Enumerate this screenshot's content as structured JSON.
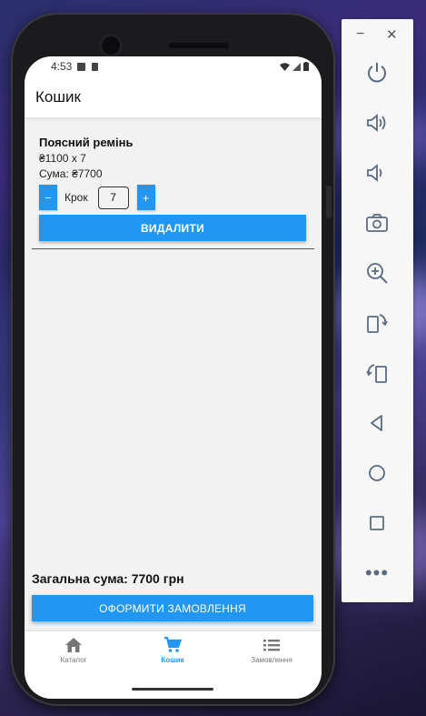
{
  "status_bar": {
    "time": "4:53"
  },
  "app_bar": {
    "title": "Кошик"
  },
  "cart_item": {
    "name": "Поясний ремінь",
    "price_line": "₴1100 x 7",
    "sum_line": "Сума: ₴7700",
    "minus_label": "−",
    "plus_label": "+",
    "step_label": "Крок",
    "quantity": "7",
    "delete_label": "ВИДАЛИТИ"
  },
  "footer": {
    "total": "Загальна сума: 7700 грн",
    "checkout_label": "ОФОРМИТИ ЗАМОВЛЕННЯ"
  },
  "bottom_nav": {
    "items": [
      {
        "label": "Каталог",
        "icon": "home-icon"
      },
      {
        "label": "Кошик",
        "icon": "cart-icon",
        "active": true
      },
      {
        "label": "Замовлення",
        "icon": "list-icon"
      }
    ]
  },
  "emulator_panel": {
    "minimize": "−",
    "close": "✕",
    "buttons": [
      "power-icon",
      "volume-up-icon",
      "volume-down-icon",
      "camera-icon",
      "zoom-in-icon",
      "rotate-left-icon",
      "rotate-right-icon",
      "back-icon",
      "home-circle-icon",
      "overview-icon",
      "more-icon"
    ],
    "more": "•••"
  },
  "colors": {
    "accent": "#2196f3",
    "panel_icon": "#5a6b80"
  }
}
